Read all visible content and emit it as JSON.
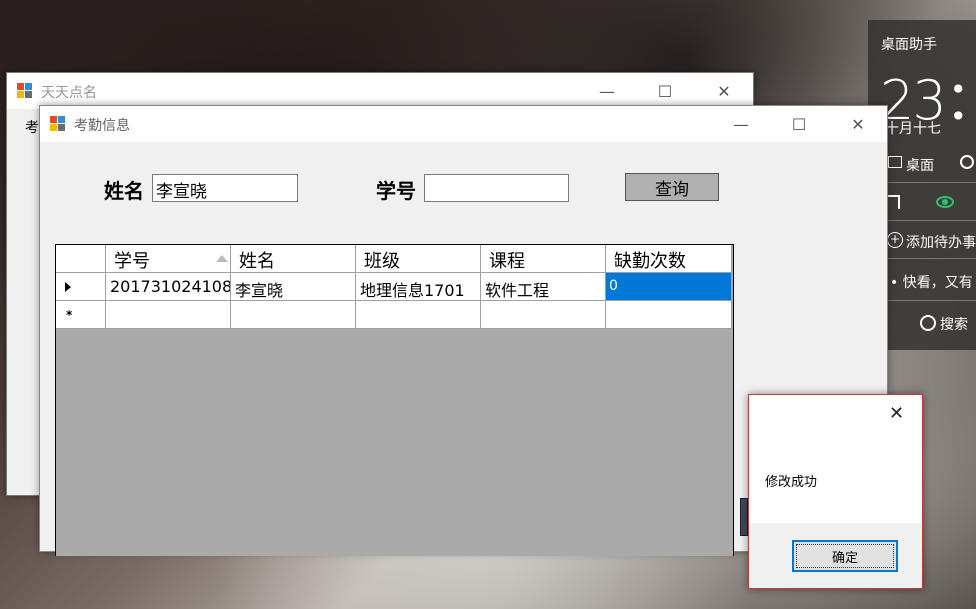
{
  "back_window": {
    "title": "天天点名",
    "menu_label": "考",
    "min_icon": "minimize-icon",
    "max_icon": "maximize-icon",
    "close_icon": "close-icon"
  },
  "main_window": {
    "title": "考勤信息",
    "name_label": "姓名",
    "name_value": "李宣晓",
    "id_label": "学号",
    "id_value": "",
    "query_button": "查询"
  },
  "grid": {
    "columns": [
      "学号",
      "姓名",
      "班级",
      "课程",
      "缺勤次数"
    ],
    "rows": [
      [
        "201731024108",
        "李宣晓",
        "地理信息1701",
        "软件工程",
        "0"
      ]
    ],
    "selected_color": "#0078d7"
  },
  "widget": {
    "title": "桌面助手",
    "time": "23：",
    "date": "十月十七",
    "desktop_label": "桌面",
    "todo_label": "添加待办事",
    "news": "• 快看，又有",
    "search_label": "搜索",
    "eye_color": "#27c46b"
  },
  "msgbox": {
    "message": "修改成功",
    "ok_button": "确定",
    "close_glyph": "✕"
  }
}
